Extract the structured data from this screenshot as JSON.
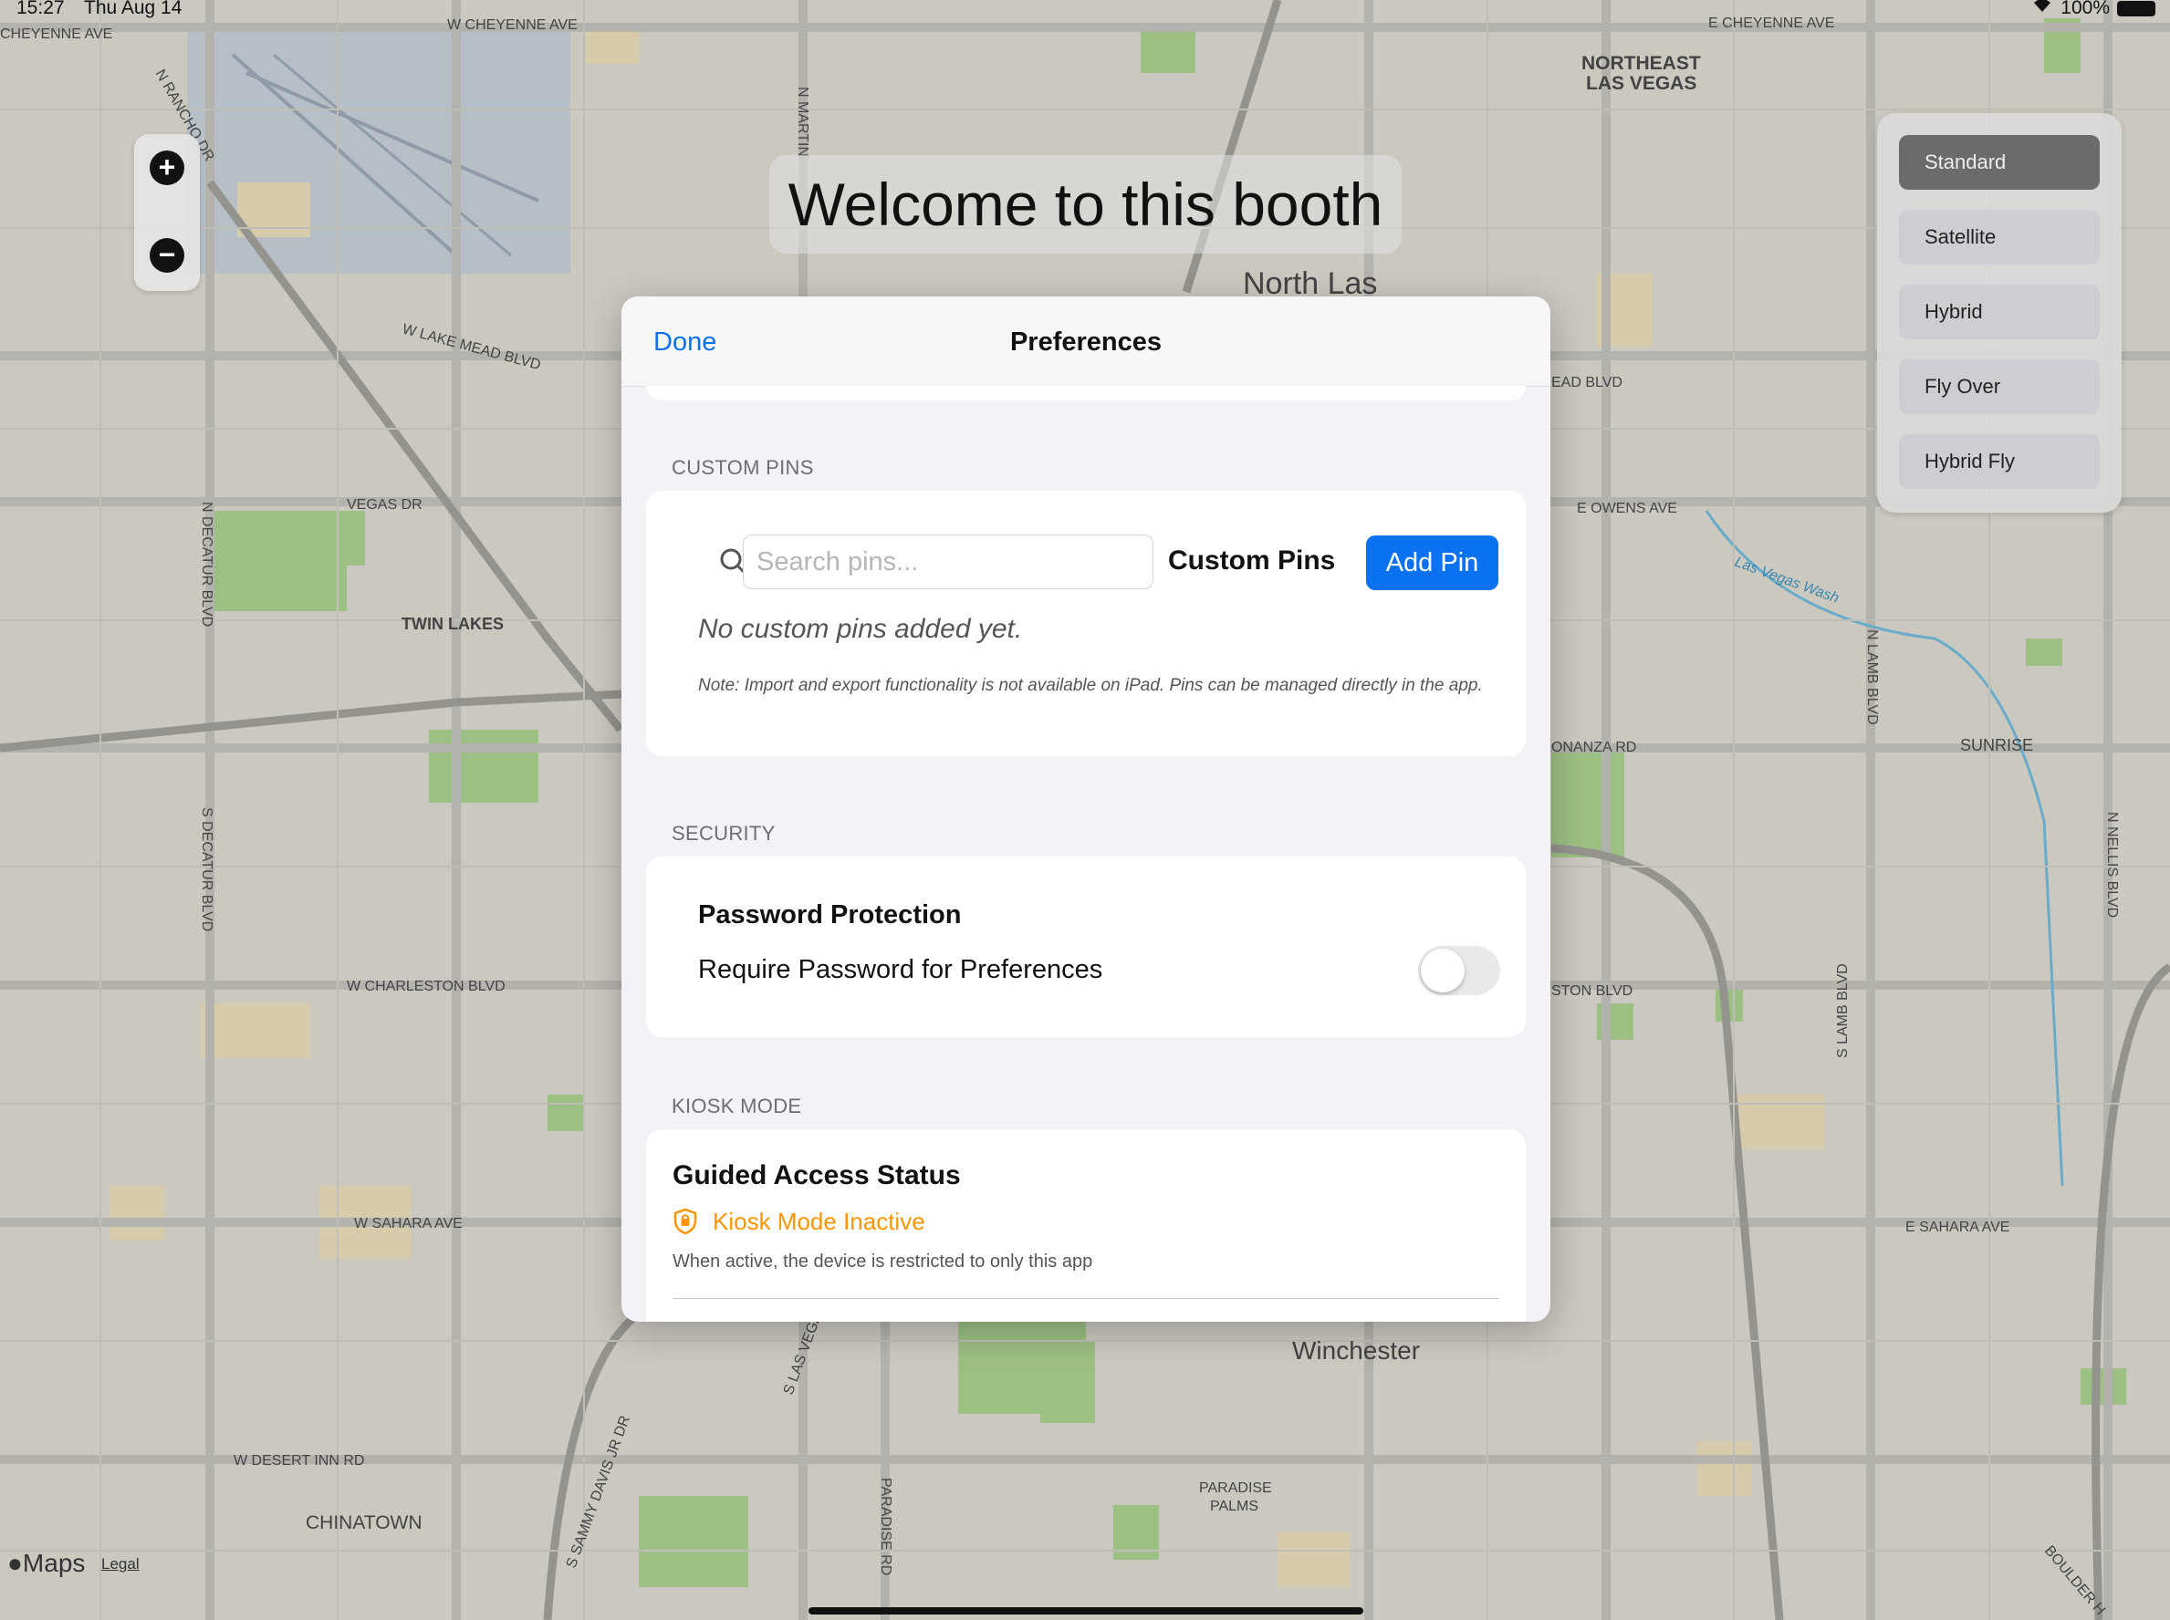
{
  "status_bar": {
    "time": "15:27",
    "date": "Thu Aug 14",
    "battery": "100%"
  },
  "map": {
    "labels": {
      "w_cheyenne": "W CHEYENNE AVE",
      "e_cheyenne": "E CHEYENNE AVE",
      "cheyenne_left": "CHEYENNE AVE",
      "northeast_lv": "NORTHEAST",
      "northeast_lv2": "LAS VEGAS",
      "north_las": "North Las",
      "w_lake_mead": "W LAKE MEAD BLVD",
      "lake_mead_right": "EAD BLVD",
      "vegas_dr": "VEGAS DR",
      "twin_lakes": "TWIN LAKES",
      "e_owens": "E OWENS AVE",
      "las_vegas_wash": "Las Vegas Wash",
      "sunrise": "SUNRISE",
      "bonanza": "ONANZA RD",
      "w_charleston": "W CHARLESTON BLVD",
      "charleston_right": "STON BLVD",
      "w_sahara": "W SAHARA AVE",
      "e_sahara": "E SAHARA AVE",
      "winchester": "Winchester",
      "w_desert_inn": "W DESERT INN RD",
      "chinatown": "CHINATOWN",
      "paradise_palms": "PARADISE",
      "paradise_palms2": "PALMS",
      "n_decatur": "N DECATUR BLVD",
      "s_decatur": "S DECATUR BLVD",
      "n_rancho": "N RANCHO DR",
      "n_martin": "N MARTIN",
      "n_lamb": "N LAMB BLVD",
      "n_nellis": "N NELLIS BLVD",
      "s_lamb": "S LAMB BLVD",
      "s_las_vegas": "S LAS VEGA",
      "sammy_davis": "S SAMMY DAVIS JR DR",
      "paradise_rd": "PARADISE RD",
      "boulder": "BOULDER H"
    }
  },
  "zoom": {
    "in_symbol": "+",
    "out_symbol": "−"
  },
  "welcome": {
    "text": "Welcome to this booth"
  },
  "map_types": {
    "selected": "Standard",
    "items": [
      "Standard",
      "Satellite",
      "Hybrid",
      "Fly Over",
      "Hybrid Fly"
    ]
  },
  "footer": {
    "maps_logo": "Maps",
    "legal": "Legal"
  },
  "preferences": {
    "done_label": "Done",
    "title": "Preferences",
    "custom_pins": {
      "section_header": "CUSTOM PINS",
      "search_placeholder": "Search pins...",
      "label": "Custom Pins",
      "add_button": "Add Pin",
      "empty_message": "No custom pins added yet.",
      "note": "Note: Import and export functionality is not available on iPad. Pins can be managed directly in the app."
    },
    "security": {
      "section_header": "SECURITY",
      "title": "Password Protection",
      "toggle_label": "Require Password for Preferences",
      "toggle_on": false
    },
    "kiosk": {
      "section_header": "KIOSK MODE",
      "title": "Guided Access Status",
      "status": "Kiosk Mode Inactive",
      "status_color": "#ff9500",
      "description": "When active, the device is restricted to only this app"
    }
  },
  "colors": {
    "accent": "#0a72f0",
    "warning": "#ff9500"
  }
}
